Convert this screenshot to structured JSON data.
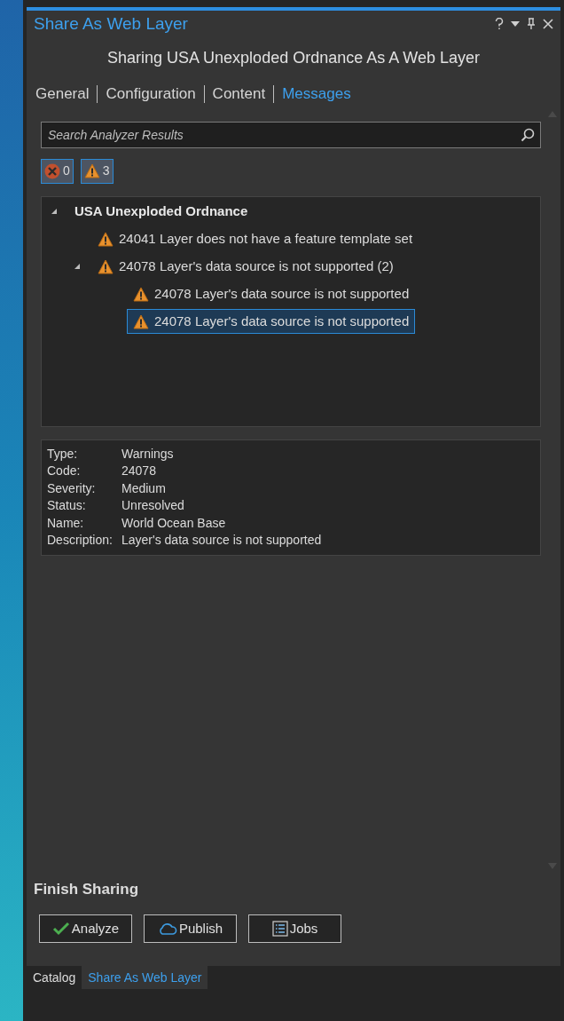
{
  "pane": {
    "title": "Share As Web Layer",
    "heading": "Sharing USA Unexploded Ordnance As A Web Layer"
  },
  "tabs": [
    {
      "label": "General",
      "selected": false
    },
    {
      "label": "Configuration",
      "selected": false
    },
    {
      "label": "Content",
      "selected": false
    },
    {
      "label": "Messages",
      "selected": true
    }
  ],
  "search": {
    "placeholder": "Search Analyzer Results"
  },
  "filters": [
    {
      "kind": "error",
      "count": "0",
      "selected": true
    },
    {
      "kind": "warning",
      "count": "3",
      "selected": true
    }
  ],
  "tree": [
    {
      "kind": "group",
      "label": "USA Unexploded Ordnance",
      "expanded": true,
      "selected": false,
      "children": [
        {
          "kind": "warning",
          "label": "24041 Layer does not have a feature template set",
          "selected": false
        },
        {
          "kind": "warning",
          "label": "24078 Layer's data source is not supported (2)",
          "expanded": true,
          "selected": false,
          "children": [
            {
              "kind": "warning",
              "label": "24078 Layer's data source is not supported",
              "selected": false
            },
            {
              "kind": "warning",
              "label": "24078 Layer's data source is not supported",
              "selected": true
            }
          ]
        }
      ]
    }
  ],
  "details": [
    {
      "label": "Type:",
      "value": "Warnings"
    },
    {
      "label": "Code:",
      "value": "24078"
    },
    {
      "label": "Severity:",
      "value": "Medium"
    },
    {
      "label": "Status:",
      "value": "Unresolved"
    },
    {
      "label": "Name:",
      "value": "World Ocean Base"
    },
    {
      "label": "Description:",
      "value": "Layer's data source is not supported"
    }
  ],
  "finish": {
    "title": "Finish Sharing",
    "buttons": [
      {
        "kind": "analyze",
        "label": "Analyze"
      },
      {
        "kind": "publish",
        "label": "Publish"
      },
      {
        "kind": "jobs",
        "label": "Jobs"
      }
    ]
  },
  "bottom_tabs": [
    {
      "label": "Catalog",
      "selected": false
    },
    {
      "label": "Share As Web Layer",
      "selected": true
    }
  ]
}
